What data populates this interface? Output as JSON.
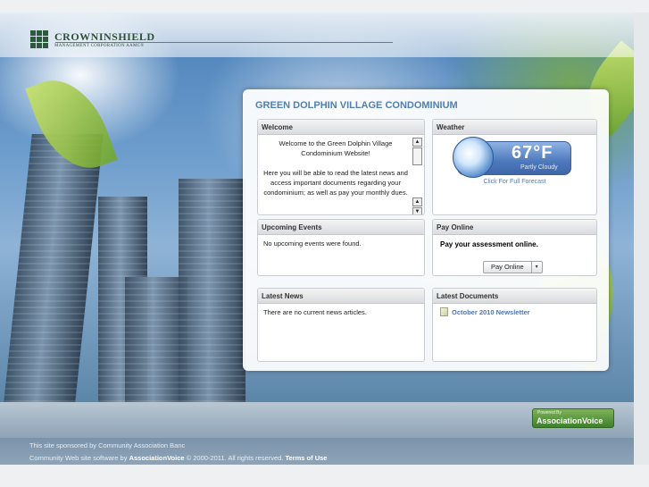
{
  "logo": {
    "name": "CROWNINSHIELD",
    "sub": "MANAGEMENT CORPORATION AAMC®"
  },
  "site_title": "GREEN DOLPHIN VILLAGE CONDOMINIUM",
  "welcome": {
    "title": "Welcome",
    "paragraph1": "Welcome to the Green Dolphin Village Condominium Website!",
    "paragraph2": "Here you will be able to read the latest news and access important documents regarding your condominium; as well as pay your monthly dues."
  },
  "weather": {
    "title": "Weather",
    "temperature": "67°F",
    "condition": "Partly Cloudy",
    "forecast_link": "Click For Full Forecast"
  },
  "events": {
    "title": "Upcoming Events",
    "empty_text": "No upcoming events were found."
  },
  "pay": {
    "title": "Pay Online",
    "text": "Pay your assessment online.",
    "button_label": "Pay Online",
    "caret": "▾"
  },
  "news": {
    "title": "Latest News",
    "empty_text": "There are no current news articles."
  },
  "documents": {
    "title": "Latest Documents",
    "items": [
      "October 2010 Newsletter"
    ]
  },
  "powered": {
    "by": "Powered By",
    "brand": "AssociationVoice"
  },
  "footer": {
    "sponsor": "This site sponsored by Community Association Banc",
    "software_prefix": "Community Web site software by",
    "software_brand": "AssociationVoice",
    "software_suffix": "© 2000-2011. All rights reserved.",
    "terms": "Terms of Use"
  }
}
